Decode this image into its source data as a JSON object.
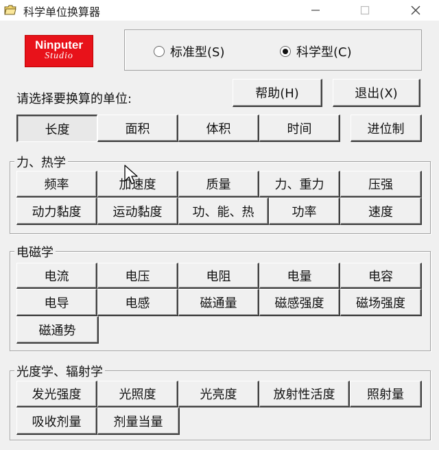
{
  "window": {
    "title": "科学单位换算器"
  },
  "logo": {
    "line1": "Ninputer",
    "line2": "Studio"
  },
  "mode": {
    "standard_label": "标准型(S)",
    "scientific_label": "科学型(C)",
    "selected": "scientific"
  },
  "prompt": "请选择要换算的单位:",
  "actions": {
    "help": "帮助(H)",
    "exit": "退出(X)"
  },
  "tabs": [
    "长度",
    "面积",
    "体积",
    "时间",
    "进位制"
  ],
  "groups": {
    "mechanics": {
      "label": "力、热学",
      "row1": [
        "频率",
        "加速度",
        "质量",
        "力、重力",
        "压强"
      ],
      "row2": [
        "动力黏度",
        "运动黏度",
        "功、能、热",
        "功率",
        "速度"
      ]
    },
    "electromagnetism": {
      "label": "电磁学",
      "row1": [
        "电流",
        "电压",
        "电阻",
        "电量",
        "电容"
      ],
      "row2": [
        "电导",
        "电感",
        "磁通量",
        "磁感强度",
        "磁场强度"
      ],
      "row3": [
        "磁通势"
      ]
    },
    "optics": {
      "label": "光度学、辐射学",
      "row1": [
        "发光强度",
        "光照度",
        "光亮度",
        "放射性活度",
        "照射量"
      ],
      "row2": [
        "吸收剂量",
        "剂量当量"
      ]
    }
  },
  "colors": {
    "logo_bg": "#e8121a",
    "window_bg": "#f0f0f0"
  }
}
